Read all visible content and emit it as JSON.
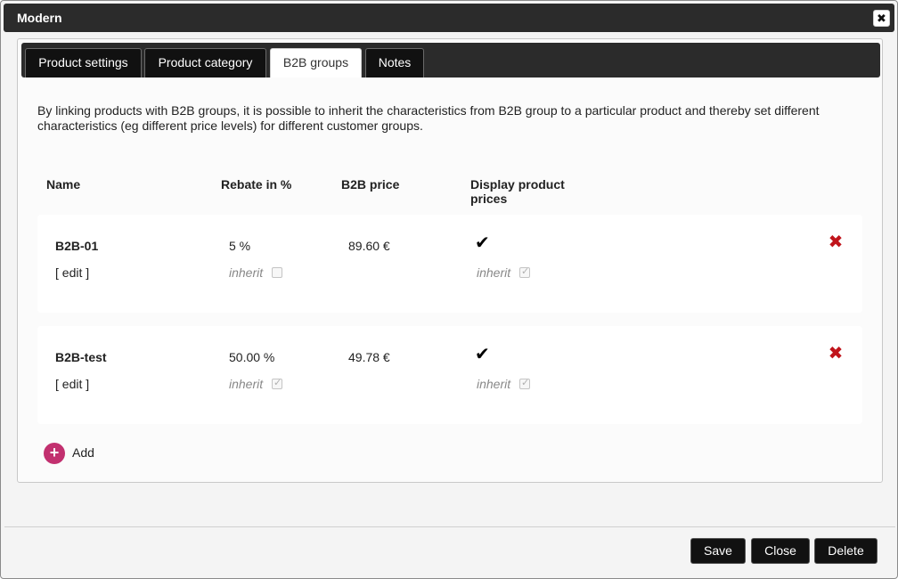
{
  "window": {
    "title": "Modern"
  },
  "tabs": [
    {
      "label": "Product settings"
    },
    {
      "label": "Product category"
    },
    {
      "label": "B2B groups",
      "active": true
    },
    {
      "label": "Notes"
    }
  ],
  "intro": "By linking products with B2B groups, it is possible to inherit the characteristics from B2B group to a particular product and thereby set different characteristics (eg different price levels) for different customer groups.",
  "table": {
    "headers": {
      "name": "Name",
      "rebate": "Rebate in %",
      "price": "B2B price",
      "display": "Display product prices"
    },
    "rows": [
      {
        "name": "B2B-01",
        "edit": "[ edit ]",
        "rebate": "5 %",
        "rebate_inherit_label": "inherit",
        "rebate_inherit_checked": false,
        "price": "89.60 €",
        "display_checked": true,
        "display_inherit_label": "inherit",
        "display_inherit_checked": true
      },
      {
        "name": "B2B-test",
        "edit": "[ edit ]",
        "rebate": "50.00 %",
        "rebate_inherit_label": "inherit",
        "rebate_inherit_checked": true,
        "price": "49.78 €",
        "display_checked": true,
        "display_inherit_label": "inherit",
        "display_inherit_checked": true
      }
    ]
  },
  "add": {
    "label": "Add"
  },
  "footer": {
    "save": "Save",
    "close": "Close",
    "delete": "Delete"
  },
  "icons": {
    "close": "close-icon",
    "check": "checkmark-icon",
    "delete": "delete-x-icon",
    "add": "plus-circle-icon"
  },
  "colors": {
    "accent_add": "#c2306f",
    "delete_red": "#c0141b",
    "bar": "#2b2b2b"
  }
}
